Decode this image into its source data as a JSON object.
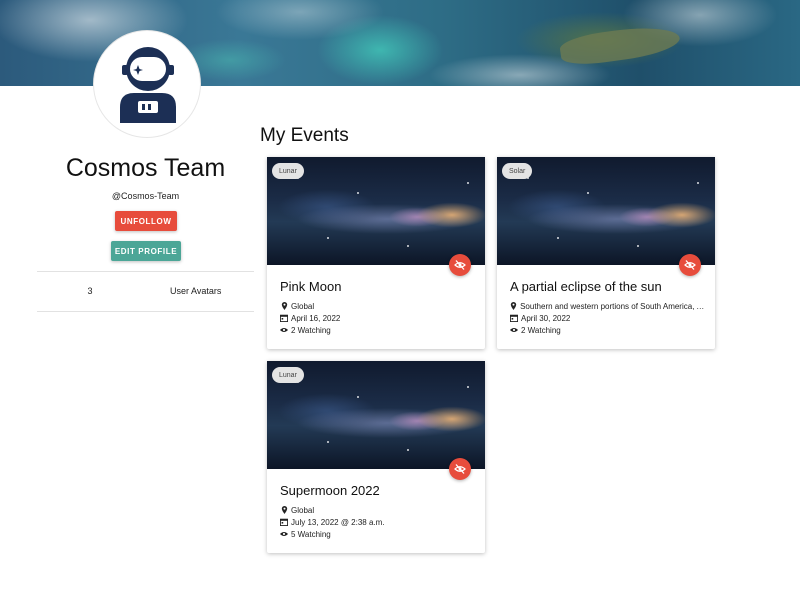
{
  "profile": {
    "name": "Cosmos Team",
    "handle": "@Cosmos-Team",
    "unfollow_label": "UNFOLLOW",
    "edit_label": "EDIT PROFILE",
    "stats": {
      "count": "3",
      "label": "User Avatars"
    }
  },
  "events": {
    "title": "My Events",
    "cards": [
      {
        "category": "Lunar",
        "title": "Pink Moon",
        "location": "Global",
        "date": "April 16, 2022",
        "watching": "2 Watching"
      },
      {
        "category": "Solar",
        "title": "A partial eclipse of the sun",
        "location": "Southern and western portions of South America, Antarctica",
        "date": "April 30, 2022",
        "watching": "2 Watching"
      },
      {
        "category": "Lunar",
        "title": "Supermoon 2022",
        "location": "Global",
        "date": "July 13, 2022 @ 2:38 a.m.",
        "watching": "5 Watching"
      }
    ]
  },
  "icons": {
    "avatar": "astronaut-icon",
    "location": "map-pin-icon",
    "date": "calendar-icon",
    "watching": "eye-icon",
    "hide": "eye-off-icon"
  },
  "colors": {
    "danger": "#e74c3c",
    "teal": "#4ca697",
    "avatar_navy": "#1c2f55"
  }
}
